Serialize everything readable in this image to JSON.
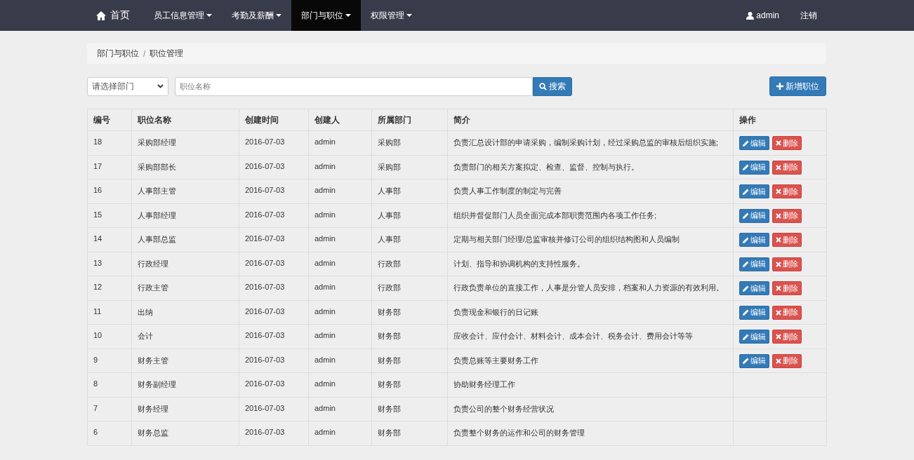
{
  "navbar": {
    "items": [
      {
        "label": "首页",
        "kind": "home",
        "selected": false
      },
      {
        "label": "员工信息管理",
        "kind": "dropdown",
        "selected": false
      },
      {
        "label": "考勤及薪酬",
        "kind": "dropdown",
        "selected": false
      },
      {
        "label": "部门与职位",
        "kind": "dropdown",
        "selected": true
      },
      {
        "label": "权限管理",
        "kind": "dropdown",
        "selected": false
      }
    ],
    "user": "admin",
    "logout": "注销"
  },
  "breadcrumb": {
    "items": [
      "部门与职位",
      "职位管理"
    ],
    "separator": "/"
  },
  "filter": {
    "department_select": "请选择部门",
    "name_placeholder": "职位名称",
    "search_button": "搜索",
    "add_button": "新增职位"
  },
  "table": {
    "columns": [
      "编号",
      "职位名称",
      "创建时间",
      "创建人",
      "所属部门",
      "简介",
      "操作"
    ],
    "rows": [
      {
        "cells": [
          "18",
          "采购部经理",
          "2016-07-03",
          "admin",
          "采购部",
          "负责汇总设计部的申请采购，编制采购计划，经过采购总监的审核后组织实施;"
        ],
        "actions": [
          "编辑",
          "删除"
        ]
      },
      {
        "cells": [
          "17",
          "采购部部长",
          "2016-07-03",
          "admin",
          "采购部",
          "负责部门的相关方案拟定、检查、监督、控制与执行。"
        ],
        "actions": [
          "编辑",
          "删除"
        ]
      },
      {
        "cells": [
          "16",
          "人事部主管",
          "2016-07-03",
          "admin",
          "人事部",
          "负责人事工作制度的制定与完善"
        ],
        "actions": [
          "编辑",
          "删除"
        ]
      },
      {
        "cells": [
          "15",
          "人事部经理",
          "2016-07-03",
          "admin",
          "人事部",
          "组织并督促部门人员全面完成本部职责范围内各项工作任务;"
        ],
        "actions": [
          "编辑",
          "删除"
        ]
      },
      {
        "cells": [
          "14",
          "人事部总监",
          "2016-07-03",
          "admin",
          "人事部",
          "定期与相关部门经理/总监审核并修订公司的组织结构图和人员编制"
        ],
        "actions": [
          "编辑",
          "删除"
        ]
      },
      {
        "cells": [
          "13",
          "行政经理",
          "2016-07-03",
          "admin",
          "行政部",
          "计划、指导和协调机构的支持性服务。"
        ],
        "actions": [
          "编辑",
          "删除"
        ]
      },
      {
        "cells": [
          "12",
          "行政主管",
          "2016-07-03",
          "admin",
          "行政部",
          "行政负责单位的直接工作，人事是分管人员安排，档案和人力资源的有效利用。"
        ],
        "actions": [
          "编辑",
          "删除"
        ]
      },
      {
        "cells": [
          "11",
          "出纳",
          "2016-07-03",
          "admin",
          "财务部",
          "负责现金和银行的日记账"
        ],
        "actions": [
          "编辑",
          "删除"
        ]
      },
      {
        "cells": [
          "10",
          "会计",
          "2016-07-03",
          "admin",
          "财务部",
          "应收会计、应付会计、材料会计、成本会计、税务会计、费用会计等等"
        ],
        "actions": [
          "编辑",
          "删除"
        ]
      },
      {
        "cells": [
          "9",
          "财务主管",
          "2016-07-03",
          "admin",
          "财务部",
          "负责总账等主要财务工作"
        ],
        "actions": [
          "编辑",
          "删除"
        ]
      },
      {
        "cells": [
          "8",
          "财务副经理",
          "2016-07-03",
          "admin",
          "财务部",
          "协助财务经理工作"
        ]
      },
      {
        "cells": [
          "7",
          "财务经理",
          "2016-07-03",
          "admin",
          "财务部",
          "负责公司的整个财务经营状况"
        ]
      },
      {
        "cells": [
          "6",
          "财务总监",
          "2016-07-03",
          "admin",
          "财务部",
          "负责整个财务的运作和公司的财务管理"
        ]
      }
    ]
  }
}
